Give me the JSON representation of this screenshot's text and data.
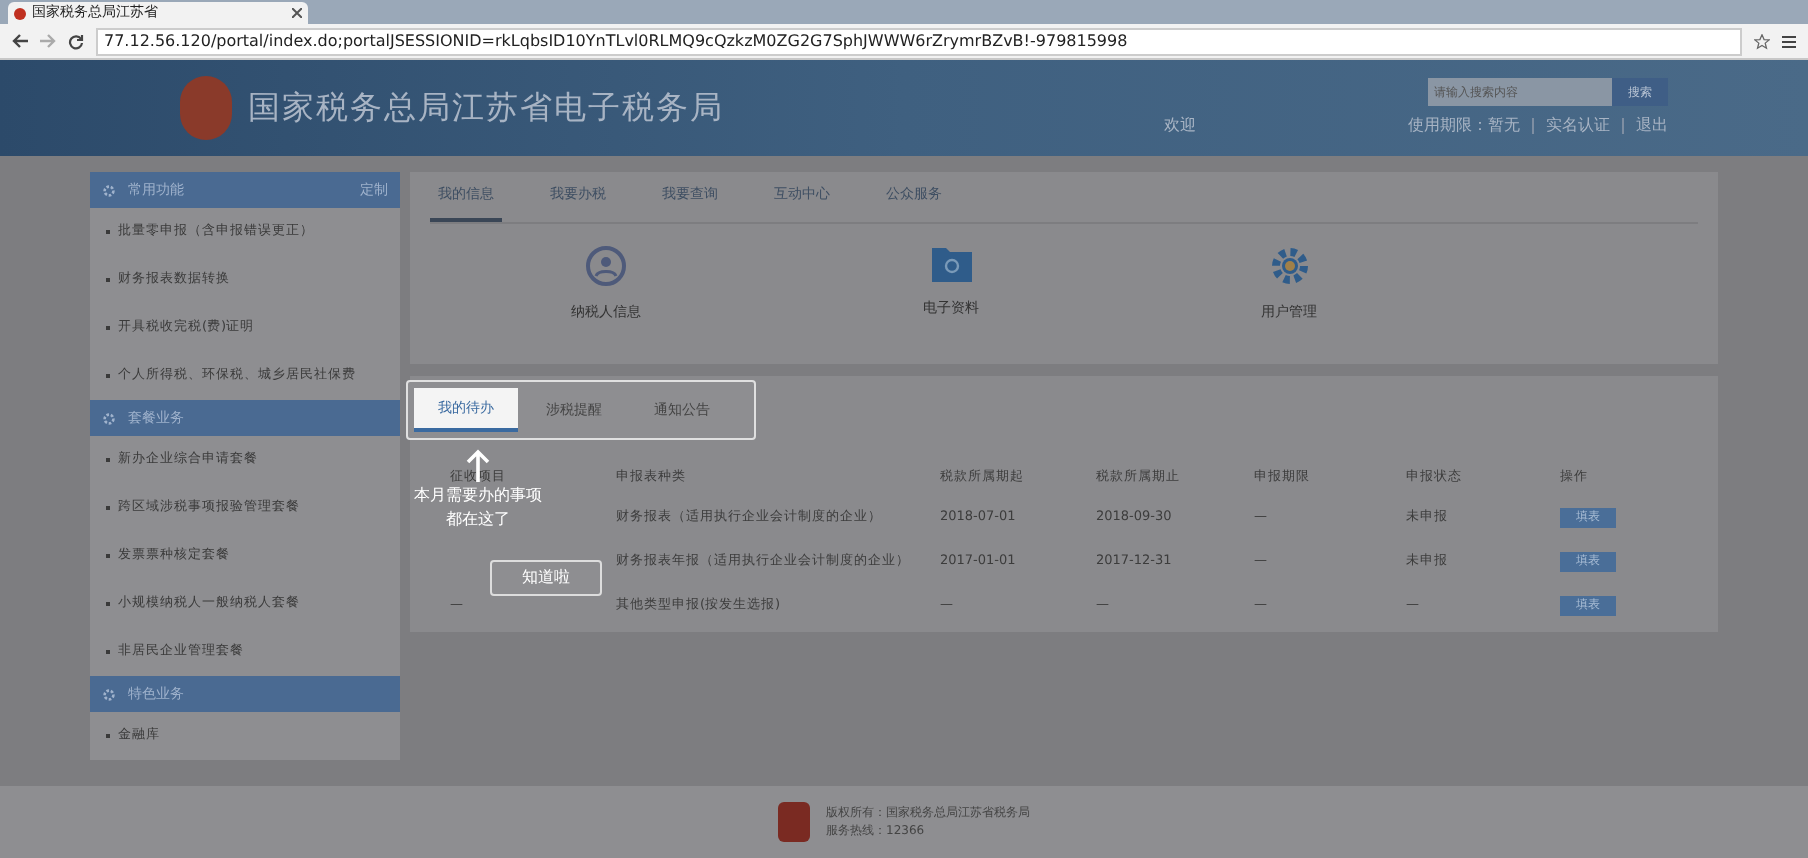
{
  "browser": {
    "tab_title": "国家税务总局江苏省",
    "url": "77.12.56.120/portal/index.do;portalJSESSIONID=rkLqbsID10YnTLvl0RLMQ9cQzkzM0ZG2G7SphJWWW6rZrymrBZvB!-979815998"
  },
  "header": {
    "site_title": "国家税务总局江苏省电子税务局",
    "search_placeholder": "请输入搜索内容",
    "search_button": "搜索",
    "welcome": "欢迎",
    "user_links": [
      "使用期限：暂无",
      "实名认证",
      "退出"
    ]
  },
  "sidebar": [
    {
      "title": "常用功能",
      "action": "定制",
      "items": [
        "批量零申报（含申报错误更正）",
        "财务报表数据转换",
        "开具税收完税(费)证明",
        "个人所得税、环保税、城乡居民社保费"
      ]
    },
    {
      "title": "套餐业务",
      "items": [
        "新办企业综合申请套餐",
        "跨区域涉税事项报验管理套餐",
        "发票票种核定套餐",
        "小规模纳税人一般纳税人套餐",
        "非居民企业管理套餐"
      ]
    },
    {
      "title": "特色业务",
      "items": [
        "金融库"
      ]
    }
  ],
  "top_tabs": [
    {
      "label": "我的信息",
      "selected": true
    },
    {
      "label": "我要办税",
      "selected": false
    },
    {
      "label": "我要查询",
      "selected": false
    },
    {
      "label": "互动中心",
      "selected": false
    },
    {
      "label": "公众服务",
      "selected": false
    }
  ],
  "shortcuts": [
    {
      "kind": "person",
      "label": "纳税人信息"
    },
    {
      "kind": "folder",
      "label": "电子资料"
    },
    {
      "kind": "gear",
      "label": "用户管理"
    }
  ],
  "todo_tabs": [
    {
      "label": "我的待办",
      "selected": true
    },
    {
      "label": "涉税提醒",
      "selected": false
    },
    {
      "label": "通知公告",
      "selected": false
    }
  ],
  "table": {
    "columns": [
      "征收项目",
      "申报表种类",
      "税款所属期起",
      "税款所属期止",
      "申报期限",
      "申报状态",
      "操作"
    ],
    "rows": [
      [
        "",
        "财务报表（适用执行企业会计制度的企业）",
        "2018-07-01",
        "2018-09-30",
        "—",
        "未申报",
        "填表"
      ],
      [
        "",
        "财务报表年报（适用执行企业会计制度的企业）",
        "2017-01-01",
        "2017-12-31",
        "—",
        "未申报",
        "填表"
      ],
      [
        "—",
        "其他类型申报(按发生选报)",
        "—",
        "—",
        "—",
        "—",
        "填表"
      ]
    ]
  },
  "guide": {
    "lines": [
      "本月需要办的事项",
      "都在这了"
    ],
    "button": "知道啦"
  },
  "footer": {
    "lines": [
      "版权所有：国家税务总局江苏省税务局",
      "服务热线：12366"
    ]
  }
}
